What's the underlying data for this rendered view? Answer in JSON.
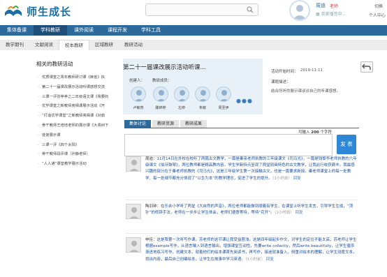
{
  "header": {
    "logo_text": "师生成长",
    "user_name": "周迪",
    "user_role": "老师",
    "user_signature": "▦ 我家播音中...",
    "switch_label": "切换",
    "center_label": "个人中心"
  },
  "main_nav": [
    {
      "label": "集体备课",
      "active": false
    },
    {
      "label": "学科教研",
      "active": true
    },
    {
      "label": "课外阅读",
      "active": false
    },
    {
      "label": "课程开发",
      "active": false
    },
    {
      "label": "学科工具",
      "active": false
    }
  ],
  "sub_nav": [
    {
      "label": "教学期刊",
      "active": false
    },
    {
      "label": "文献阅读",
      "active": false
    },
    {
      "label": "校本教研",
      "active": true
    },
    {
      "label": "区域教研",
      "active": false
    },
    {
      "label": "教研活动",
      "active": false
    }
  ],
  "related": {
    "heading": "相关的教研活动",
    "items": [
      "优质课堂之青年教师研讨课《麻雀》执",
      "第二十一届课改展示活动听课感想交流",
      "三课一评张亭亭之二年级语文课《我要的",
      "优学课堂之新教师亮相课展示活动《开",
      "“打造优学课堂”之新教师亮相课《对韵",
      "骨干教师王培培老师的展示课《大青树下",
      "徒弟展示课",
      "三课一评《四个太阳》",
      "骨干教师段评课（孙静老师）",
      "“人人通”课堂教学展示活动"
    ]
  },
  "activity": {
    "title": "第二十一届课改展示活动听课...",
    "creator_label": "创建人：",
    "member_label": "教研成员：",
    "people": [
      {
        "name": "卢敏燕"
      },
      {
        "name": "滕婷婷"
      },
      {
        "name": "左婷"
      },
      {
        "name": "朱敏"
      },
      {
        "name": "周圣伊"
      }
    ],
    "more_symbol": "●●●",
    "start_time_label": "活动开始时间：",
    "start_time": "2019-11-11",
    "topic_label": "课题描述：",
    "topic_desc": "结合所听的展示课谈谈自己的听课感想。"
  },
  "discussion": {
    "tabs": [
      {
        "label": "集体讨论",
        "active": true
      },
      {
        "label": "教研资源",
        "active": false
      },
      {
        "label": "教研成果",
        "active": false
      }
    ],
    "limit_prefix": "可输入",
    "limit_count": "200",
    "limit_suffix": "个字符",
    "publish_label": "发 表"
  },
  "comments": [
    {
      "author": "周迪：",
      "body": "11月14日在外校在校听了两篇古文教学，一篇是秦亲老师执教的三年级课文《司马光》，一篇是钱黎华老师执教的六年级课文《伯牙鼓琴》，两位教师都是精品教内容，学生学新特点呈现了两堂别具特色的古文教学，让我此行收获颇丰。我最感兴趣的部分在于秦老师执教的《司马光》，这是三年级学生第一次接触古文，也是一篇要求新授。秦老师课堂上的每一处教学、每一处细节都充分体现了“以生为本”的教学理念，促进了学生的提升。",
      "meta": "（1小时前）",
      "reply": "回复"
    },
    {
      "author": "陶羽钟：",
      "body": "在乐余小学听了两堂《大自然的声音》，两位老师都能做到顺着有学生，在课堂上听学生发言，引导学生生成，“顶针”的修辞手法，老师在一步步让学生体会，老师们遵意等待，等待“花开”。",
      "meta": "（1小时前）",
      "reply": "回复"
    },
    {
      "author": "申佳：",
      "body": "这是我第一次听写作课，苏老师的这节课让我受益匪浅。这是四年级起步作文，对学生的定位不能太高，苏老师让学生根据example写作，从语言输入到语言输出，增强课堂互动性，先要write collectly，然后write beautifully，让学生循序渐进地练习写作，创建文本，就着他们的绘本课首先阅读书，再写作，接迷就准备入，侧重对绘本的理解，让学生测度文本，找出内容，最后自己创编绘本，让学生在故事中学习英语。",
      "meta": "（1小时前）",
      "reply": "回复"
    }
  ],
  "colors": {
    "nav_bg": "#2d6a9c",
    "nav_active": "#1f4f78",
    "panel_bg": "#e8f0f8",
    "comment_text": "#1a4fa0",
    "publish_button": "#2e88d6"
  }
}
